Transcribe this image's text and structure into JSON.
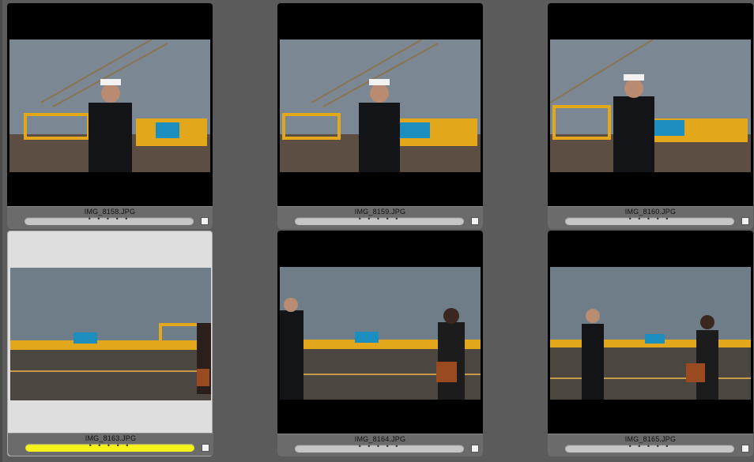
{
  "thumbnails": [
    {
      "filename": "IMG_8158.JPG",
      "rating_dots": "• • • • •",
      "selected": false,
      "label_color": "#c6c6c6"
    },
    {
      "filename": "IMG_8159.JPG",
      "rating_dots": "• • • • •",
      "selected": false,
      "label_color": "#c6c6c6"
    },
    {
      "filename": "IMG_8160.JPG",
      "rating_dots": "• • • • •",
      "selected": false,
      "label_color": "#c6c6c6"
    },
    {
      "filename": "IMG_8163.JPG",
      "rating_dots": "• • • • •",
      "selected": true,
      "label_color": "#f6f21a"
    },
    {
      "filename": "IMG_8164.JPG",
      "rating_dots": "• • • • •",
      "selected": false,
      "label_color": "#c6c6c6"
    },
    {
      "filename": "IMG_8165.JPG",
      "rating_dots": "• • • • •",
      "selected": false,
      "label_color": "#c6c6c6"
    }
  ]
}
